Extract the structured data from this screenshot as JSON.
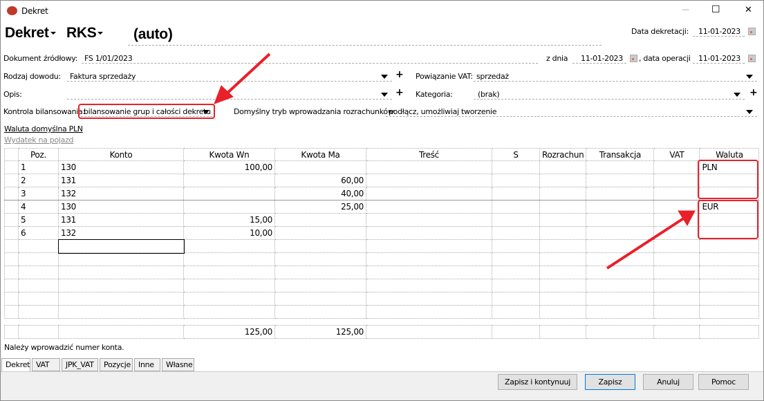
{
  "window": {
    "title": "Dekret",
    "minimize": "—",
    "maximize": "☐",
    "close": "✕"
  },
  "header": {
    "type": "Dekret",
    "journal": "RKS",
    "number": "(auto)",
    "date_label": "Data dekretacji:",
    "date": "11-01-2023"
  },
  "form": {
    "source_doc_label": "Dokument źródłowy:",
    "source_doc": "FS 1/01/2023",
    "from_date_label": "z dnia",
    "from_date": "11-01-2023",
    "op_date_label": ", data operacji",
    "op_date": "11-01-2023",
    "proof_type_label": "Rodzaj dowodu:",
    "proof_type": "Faktura sprzedaży",
    "vat_link_label": "Powiązanie VAT:",
    "vat_link": "sprzedaż",
    "desc_label": "Opis:",
    "desc": "",
    "category_label": "Kategoria:",
    "category": "(brak)",
    "balance_label": "Kontrola bilansowania:",
    "balance": "bilansowanie grup i całości dekretu",
    "settle_label": "Domyślny tryb wprowadzania rozrachunków:",
    "settle": "podłącz, umożliwiaj tworzenie",
    "currency_link": "Waluta domyślna PLN",
    "vehicle_link": "Wydatek na pojazd"
  },
  "table": {
    "columns": [
      "Poz.",
      "Konto",
      "Kwota Wn",
      "Kwota Ma",
      "Treść",
      "S",
      "Rozrachun",
      "Transakcja",
      "VAT",
      "Waluta"
    ],
    "rows": [
      {
        "poz": "1",
        "konto": "130",
        "wn": "100,00",
        "ma": "",
        "waluta": "PLN"
      },
      {
        "poz": "2",
        "konto": "131",
        "wn": "",
        "ma": "60,00",
        "waluta": ""
      },
      {
        "poz": "3",
        "konto": "132",
        "wn": "",
        "ma": "40,00",
        "waluta": ""
      },
      {
        "poz": "4",
        "konto": "130",
        "wn": "",
        "ma": "25,00",
        "waluta": "EUR"
      },
      {
        "poz": "5",
        "konto": "131",
        "wn": "15,00",
        "ma": "",
        "waluta": ""
      },
      {
        "poz": "6",
        "konto": "132",
        "wn": "10,00",
        "ma": "",
        "waluta": ""
      }
    ],
    "total_wn": "125,00",
    "total_ma": "125,00"
  },
  "status": "Należy wprowadzić numer konta.",
  "tabs": [
    "Dekret",
    "VAT",
    "JPK_VAT",
    "Pozycje",
    "Inne",
    "Własne"
  ],
  "buttons": {
    "save_continue": "Zapisz i kontynuuj",
    "save": "Zapisz",
    "cancel": "Anuluj",
    "help": "Pomoc"
  },
  "colors": {
    "annotation": "#e8202a"
  }
}
